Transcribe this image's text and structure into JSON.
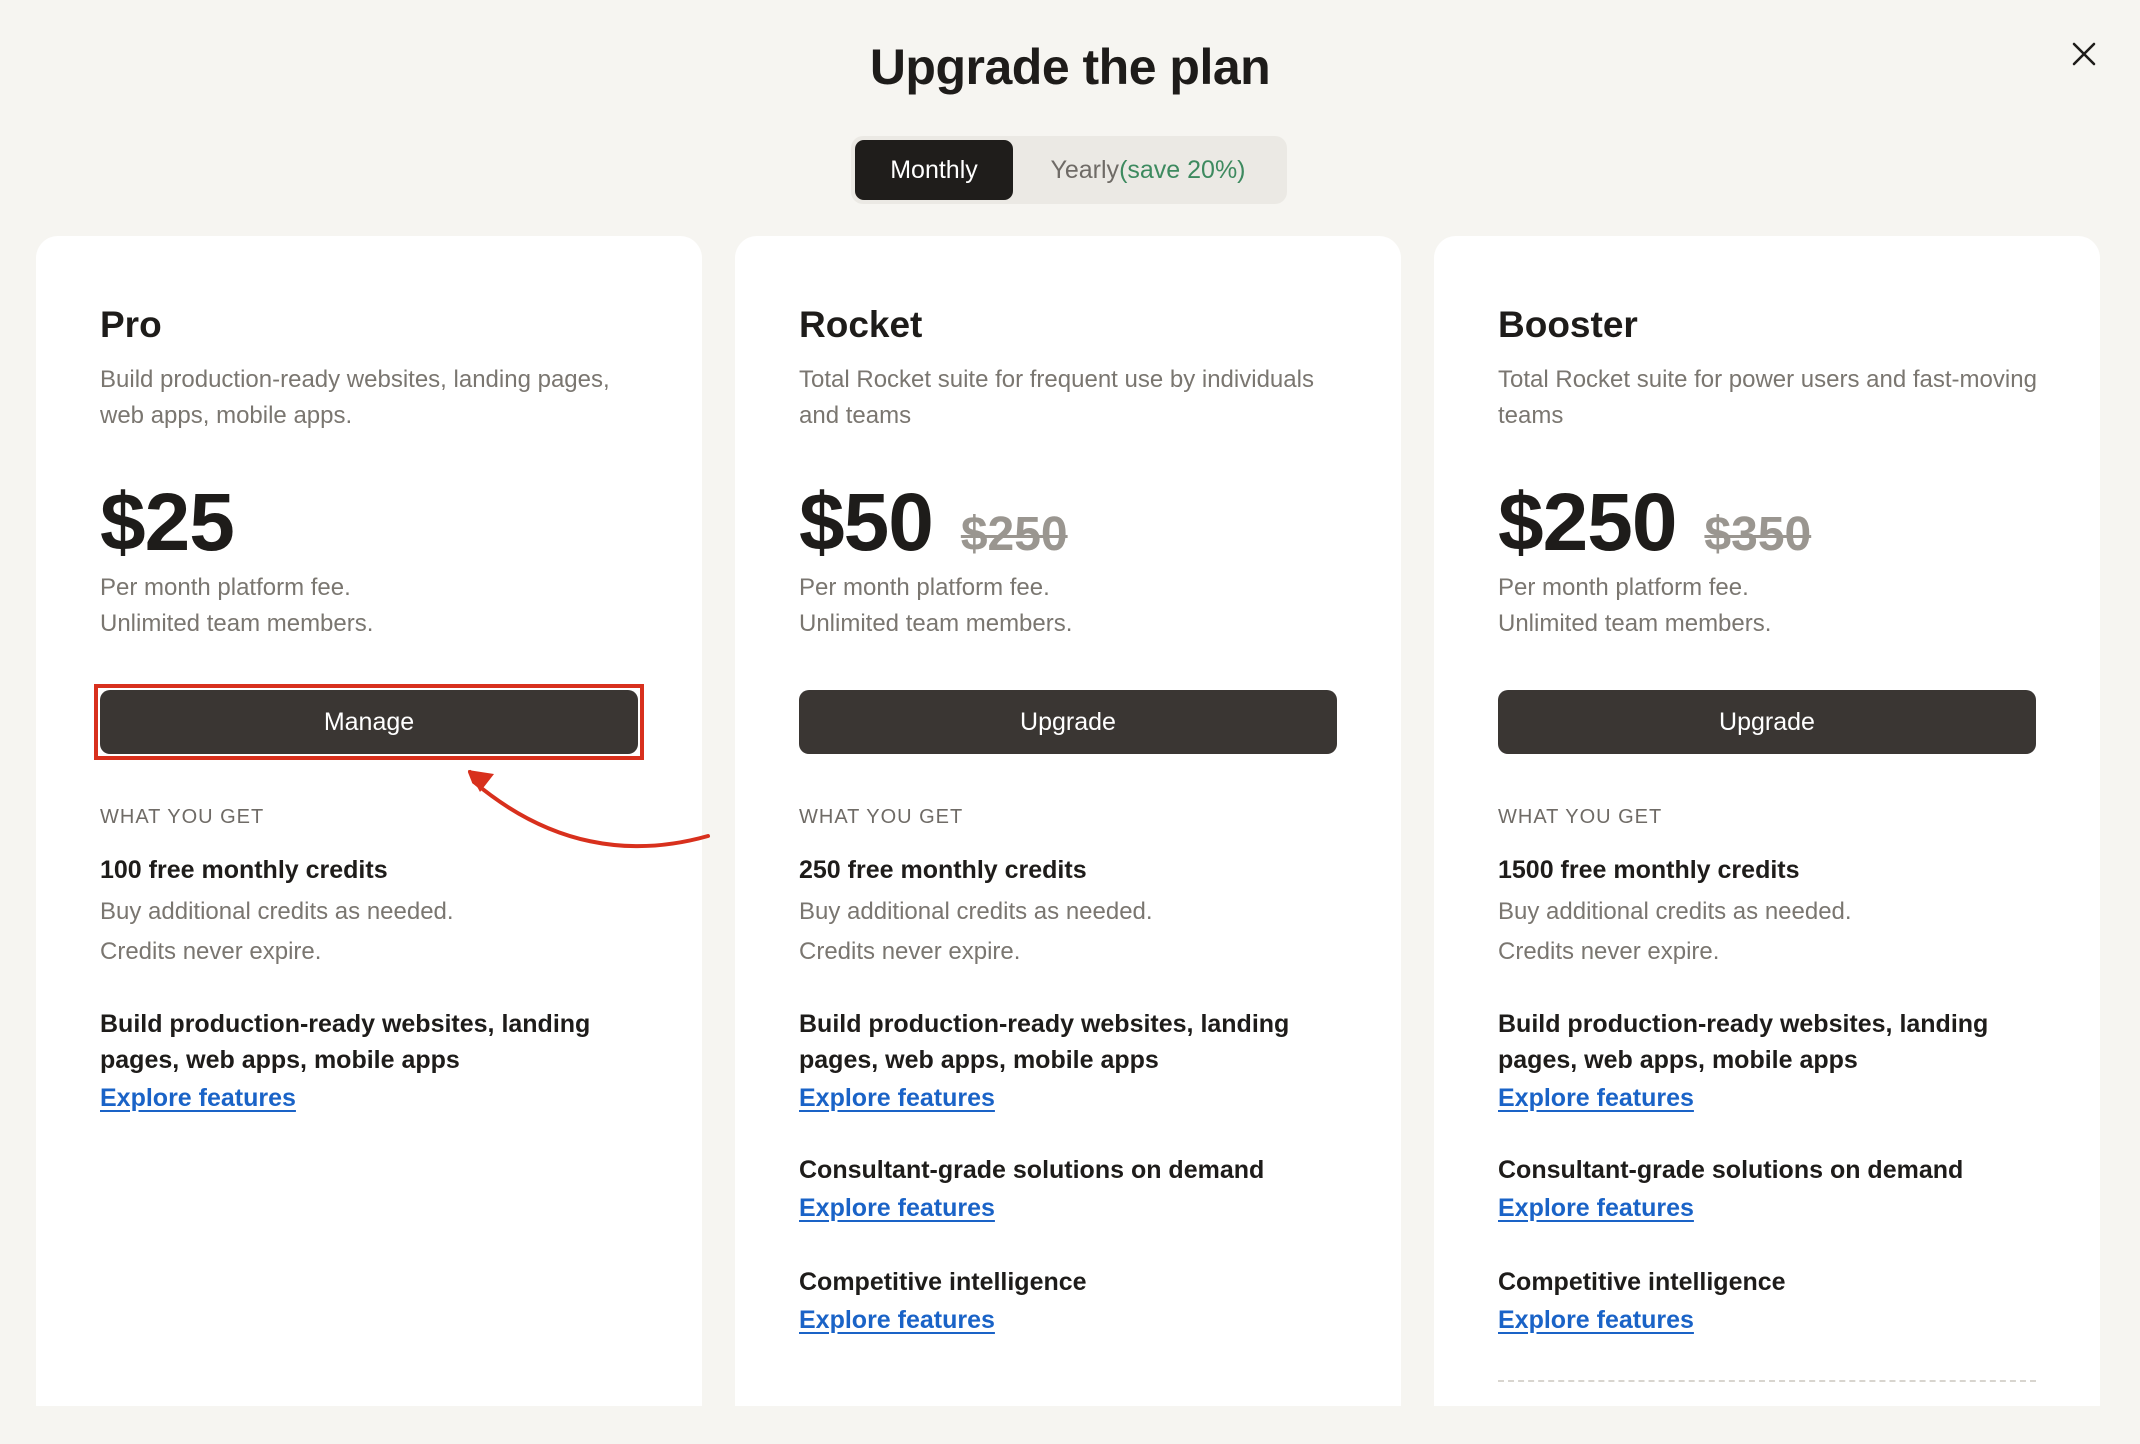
{
  "header": {
    "title": "Upgrade the plan",
    "close_icon": "close-icon"
  },
  "billing_toggle": {
    "monthly_label": "Monthly",
    "yearly_label": "Yearly",
    "yearly_badge": "(save 20%)",
    "selected": "Monthly"
  },
  "colors": {
    "background": "#f6f5f1",
    "card": "#ffffff",
    "button": "#3a3633",
    "link": "#1a63c7",
    "save_green": "#3d8a5f",
    "highlight_red": "#d8301d"
  },
  "plans": [
    {
      "name": "Pro",
      "description": "Build production-ready websites, landing pages, web apps, mobile apps.",
      "price": "$25",
      "old_price": "",
      "fee_line1": "Per month platform fee.",
      "fee_line2": "Unlimited team members.",
      "cta": "Manage",
      "what_you_get": "WHAT YOU GET",
      "credits": "100 free monthly credits",
      "credits_sub1": "Buy additional credits as needed.",
      "credits_sub2": "Credits never expire.",
      "features": [
        {
          "title": "Build production-ready websites, landing pages, web apps, mobile apps",
          "link": "Explore features"
        }
      ]
    },
    {
      "name": "Rocket",
      "description": "Total Rocket suite for frequent use by individuals and teams",
      "price": "$50",
      "old_price": "$250",
      "fee_line1": "Per month platform fee.",
      "fee_line2": "Unlimited team members.",
      "cta": "Upgrade",
      "what_you_get": "WHAT YOU GET",
      "credits": "250 free monthly credits",
      "credits_sub1": "Buy additional credits as needed.",
      "credits_sub2": "Credits never expire.",
      "features": [
        {
          "title": "Build production-ready websites, landing pages, web apps, mobile apps",
          "link": "Explore features"
        },
        {
          "title": "Consultant-grade solutions on demand",
          "link": "Explore features"
        },
        {
          "title": "Competitive intelligence",
          "link": "Explore features"
        }
      ]
    },
    {
      "name": "Booster",
      "description": "Total Rocket suite for power users and fast-moving teams",
      "price": "$250",
      "old_price": "$350",
      "fee_line1": "Per month platform fee.",
      "fee_line2": "Unlimited team members.",
      "cta": "Upgrade",
      "what_you_get": "WHAT YOU GET",
      "credits": "1500 free monthly credits",
      "credits_sub1": "Buy additional credits as needed.",
      "credits_sub2": "Credits never expire.",
      "features": [
        {
          "title": "Build production-ready websites, landing pages, web apps, mobile apps",
          "link": "Explore features"
        },
        {
          "title": "Consultant-grade solutions on demand",
          "link": "Explore features"
        },
        {
          "title": "Competitive intelligence",
          "link": "Explore features"
        }
      ]
    }
  ]
}
